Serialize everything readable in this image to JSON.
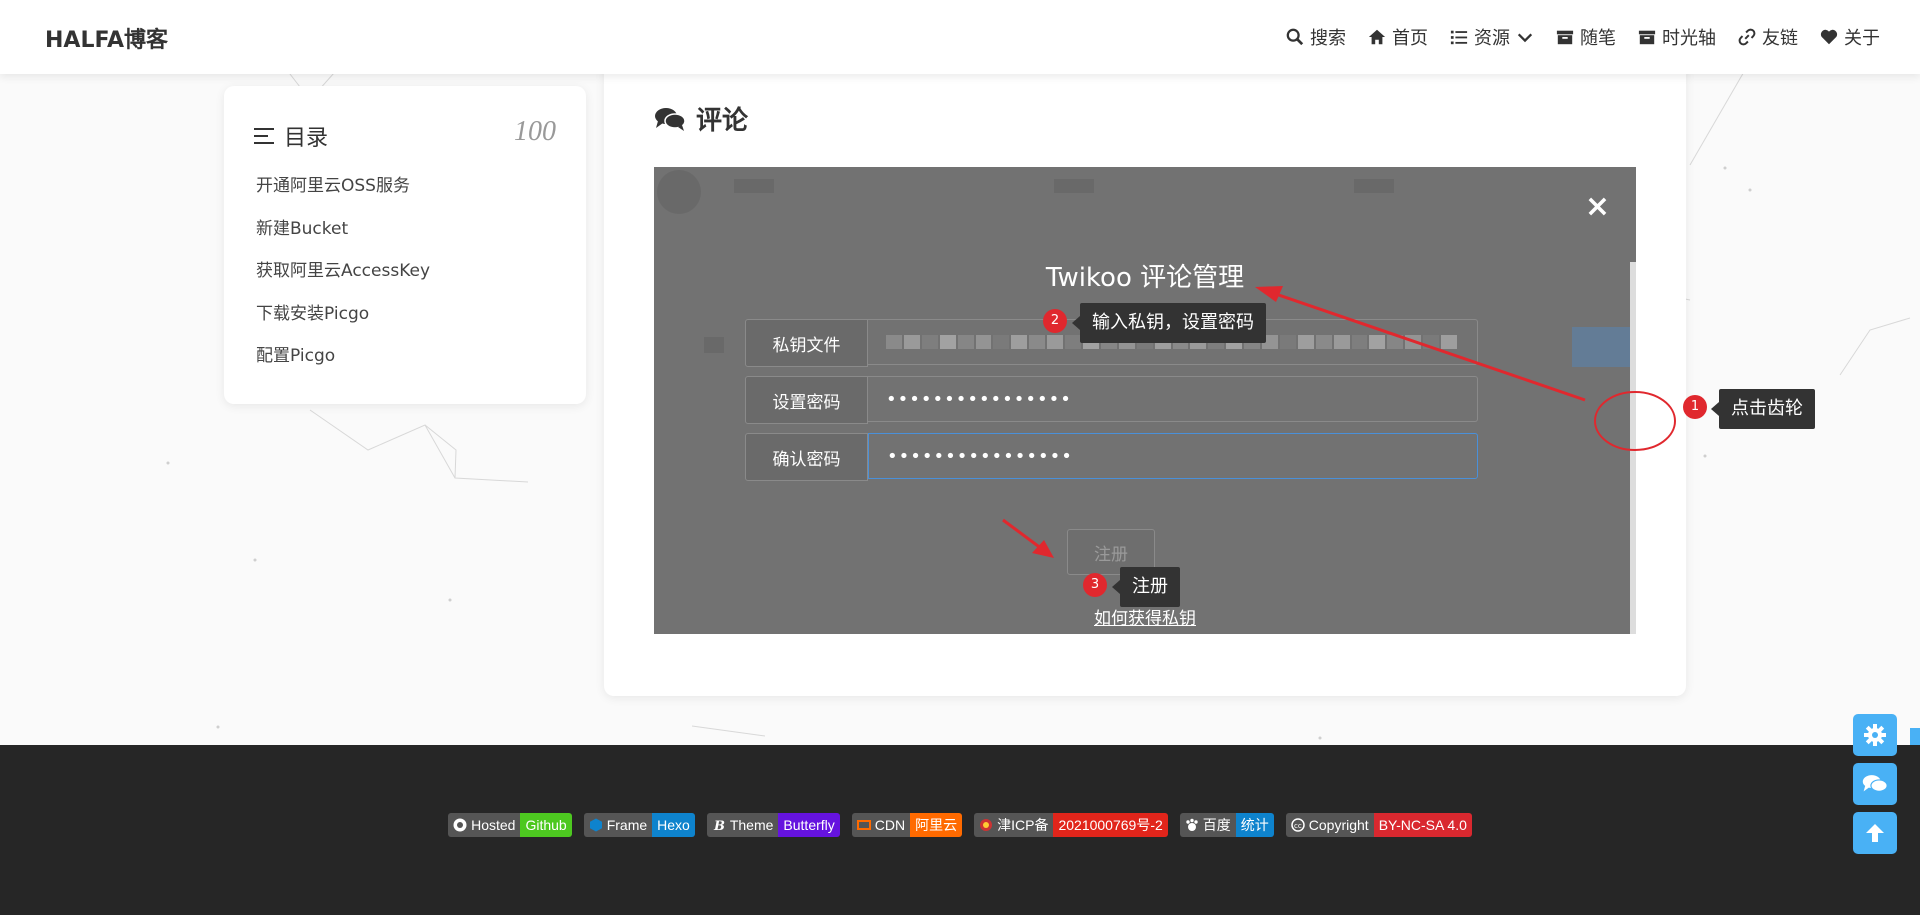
{
  "header": {
    "logo": "HALFA博客",
    "nav": [
      {
        "label": "搜索",
        "icon": "search-icon"
      },
      {
        "label": "首页",
        "icon": "home-icon"
      },
      {
        "label": "资源",
        "icon": "list-icon"
      },
      {
        "label": "随笔",
        "icon": "archive-icon"
      },
      {
        "label": "时光轴",
        "icon": "archive-icon"
      },
      {
        "label": "友链",
        "icon": "link-icon"
      },
      {
        "label": "关于",
        "icon": "heart-icon"
      }
    ]
  },
  "toc": {
    "title": "目录",
    "percent": "100",
    "items": [
      "开通阿里云OSS服务",
      "新建Bucket",
      "获取阿里云AccessKey",
      "下载安装Picgo",
      "配置Picgo"
    ]
  },
  "comments": {
    "heading": "评论"
  },
  "modal": {
    "close": "×",
    "title": "Twikoo 评论管理",
    "fields": [
      {
        "label": "私钥文件",
        "value": ""
      },
      {
        "label": "设置密码",
        "value": "••••••••••••••••"
      },
      {
        "label": "确认密码",
        "value": "••••••••••••••••"
      }
    ],
    "register": "注册",
    "help_link": "如何获得私钥"
  },
  "annotations": [
    {
      "number": "1",
      "text": "点击齿轮"
    },
    {
      "number": "2",
      "text": "输入私钥，设置密码"
    },
    {
      "number": "3",
      "text": "注册"
    }
  ],
  "footer": {
    "badges": [
      {
        "left": "Hosted",
        "right": "Github",
        "color": "#4dc820",
        "icon": "github-icon"
      },
      {
        "left": "Frame",
        "right": "Hexo",
        "color": "#0e83cd",
        "icon": "hexo-icon"
      },
      {
        "left": "Theme",
        "right": "Butterfly",
        "color": "#6513df",
        "icon": "butterfly-icon"
      },
      {
        "left": "CDN",
        "right": "阿里云",
        "color": "#ff6a00",
        "icon": "aliyun-icon"
      },
      {
        "left": "津ICP备",
        "right": "2021000769号-2",
        "color": "#e1251b",
        "icon": "police-icon"
      },
      {
        "left": "百度",
        "right": "统计",
        "color": "#0e83cd",
        "icon": "baidu-icon"
      },
      {
        "left": "Copyright",
        "right": "BY-NC-SA 4.0",
        "color": "#d9282f",
        "icon": "cc-icon"
      }
    ]
  },
  "colors": {
    "accent": "#49b1f5",
    "modal_bg": "#727272",
    "annotation_red": "#e0282e",
    "footer_bg": "#262626"
  }
}
